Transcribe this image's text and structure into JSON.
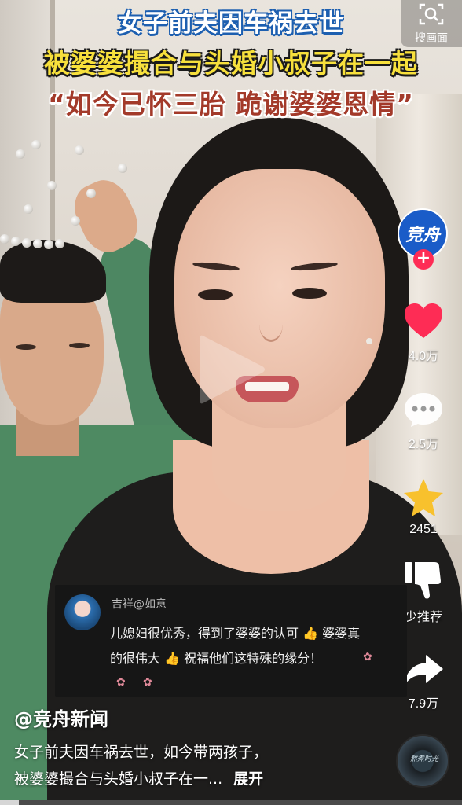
{
  "headline": {
    "line1": "女子前夫因车祸去世",
    "line2": "被婆婆撮合与头婚小叔子在一起",
    "line3": "“如今已怀三胎 跪谢婆婆恩情”"
  },
  "search_image": {
    "label": "搜画面",
    "icon": "scan-search-icon"
  },
  "rail": {
    "avatar_label": "竞舟",
    "follow_label": "+",
    "like_count": "4.0万",
    "comment_count": "2.5万",
    "favorite_count": "2451",
    "dislike_label": "少推荐",
    "share_count": "7.9万"
  },
  "comment": {
    "user": "吉祥@如意",
    "line1": "儿媳妇很优秀，得到了婆婆的认可",
    "line1b": "婆婆真",
    "line2a": "的很伟大",
    "line2b": "祝福他们这特殊的缘分！",
    "thumb": "👍"
  },
  "author": "@竞舟新闻",
  "caption": {
    "line1": "女子前夫因车祸去世，如今带两孩子，",
    "line2": "被婆婆撮合与头婚小叔子在一...",
    "expand": "展开"
  },
  "music_disc": {
    "text": "熬煮时光"
  },
  "progress": {
    "fraction": 0.04
  },
  "colors": {
    "like": "#fe2c55",
    "favorite": "#f8c12d",
    "follow_badge": "#fe2c55",
    "headline_yellow": "#f7e03c",
    "headline_red": "#a33a2a"
  }
}
